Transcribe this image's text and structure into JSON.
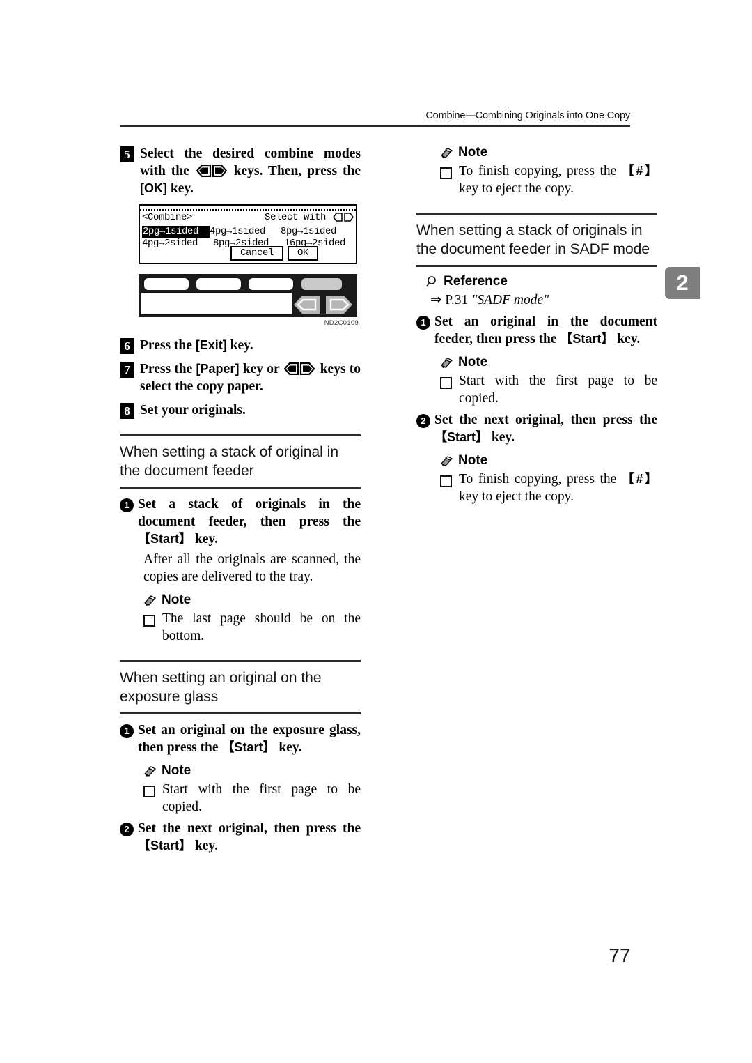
{
  "header": {
    "running_title": "Combine—Combining Originals into One Copy"
  },
  "chapter_tab": {
    "number": "2"
  },
  "page_number": "77",
  "left_column": {
    "step5": {
      "number": "5",
      "text_part1": "Select the desired combine modes with the",
      "text_part2": "keys. Then, press the",
      "key_ok": "[OK]",
      "text_part3": "key."
    },
    "lcd": {
      "title": "<Combine>",
      "hint": "Select with",
      "options_row1": [
        "2pg→1sided",
        "4pg→1sided",
        "8pg→1sided"
      ],
      "options_row2": [
        "4pg→2sided",
        "8pg→2sided",
        "16pg→2sided"
      ],
      "selected_option": "2pg→1sided",
      "cancel_button": "Cancel",
      "ok_button": "OK"
    },
    "panel_figure": {
      "figure_id": "ND2C0109"
    },
    "step6": {
      "number": "6",
      "text_part1": "Press the",
      "key": "[Exit]",
      "text_part2": "key."
    },
    "step7": {
      "number": "7",
      "text_part1": "Press the",
      "key": "[Paper]",
      "text_part2": "key or",
      "text_part3": "keys to select the copy paper."
    },
    "step8": {
      "number": "8",
      "text": "Set your originals."
    },
    "section_feeder": {
      "title": "When setting a stack of original in the document feeder",
      "substep1": {
        "number": "1",
        "text_part1": "Set a stack of originals in the document feeder, then press the",
        "key_start": "【Start】",
        "text_part2": "key."
      },
      "paragraph": "After all the originals are scanned, the copies are delivered to the tray.",
      "note_label": "Note",
      "note_item": "The last page should be on the bottom."
    },
    "section_glass": {
      "title": "When setting an original on the exposure glass",
      "substep1": {
        "number": "1",
        "text_part1": "Set an original on the exposure glass, then press the",
        "key_start": "【Start】",
        "text_part2": "key."
      },
      "note_label": "Note",
      "note_item": "Start with the first page to be copied.",
      "substep2": {
        "number": "2",
        "text_part1": "Set the next original, then press the",
        "key_start": "【Start】",
        "text_part2": "key."
      }
    }
  },
  "right_column": {
    "note_top": {
      "label": "Note",
      "text_part1": "To finish copying, press the",
      "key_hash": "【#】",
      "text_part2": "key to eject the copy."
    },
    "section_sadf": {
      "title": "When setting a stack of originals in the document feeder in SADF mode",
      "reference_label": "Reference",
      "reference_text_arrow": "⇒",
      "reference_page": "P.31",
      "reference_title": "\"SADF mode\"",
      "substep1": {
        "number": "1",
        "text_part1": "Set an original in the document feeder, then press the",
        "key_start": "【Start】",
        "text_part2": "key."
      },
      "note1_label": "Note",
      "note1_item": "Start with the first page to be copied.",
      "substep2": {
        "number": "2",
        "text_part1": "Set the next original, then press the",
        "key_start": "【Start】",
        "text_part2": "key."
      },
      "note2_label": "Note",
      "note2_text_part1": "To finish copying, press the",
      "note2_key_hash": "【#】",
      "note2_text_part2": "key to eject the copy."
    }
  }
}
